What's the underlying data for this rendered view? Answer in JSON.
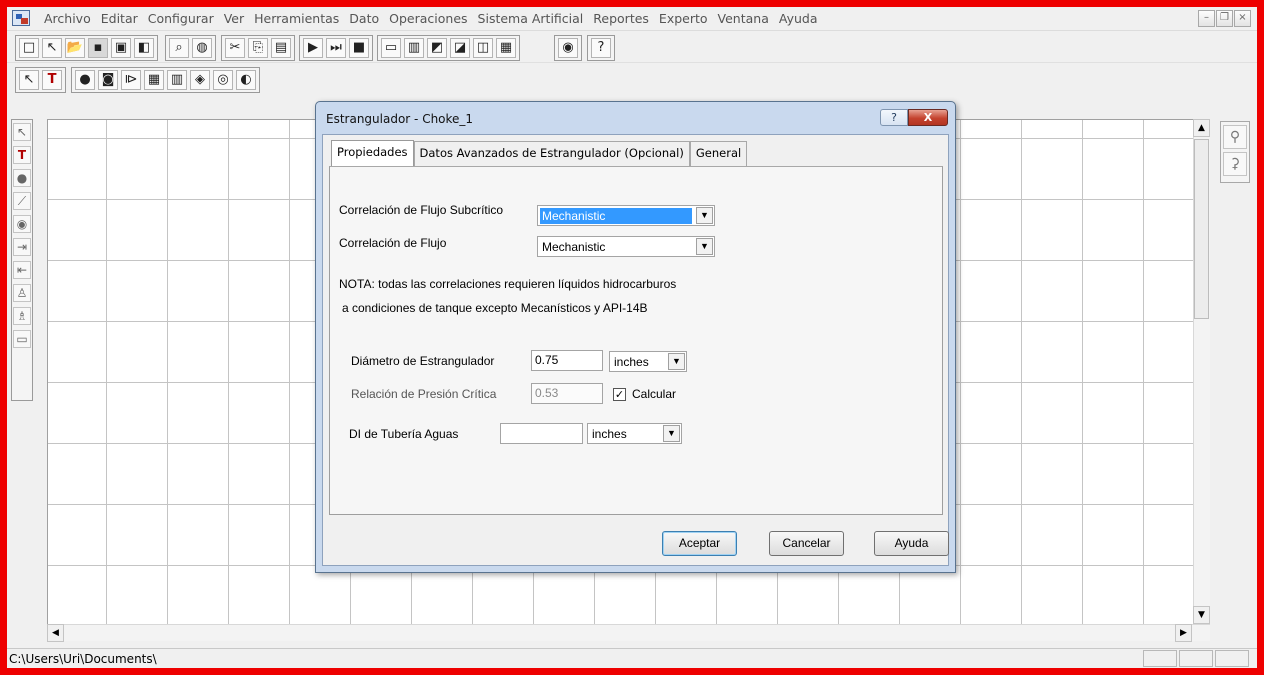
{
  "menubar": {
    "items": [
      "Archivo",
      "Editar",
      "Configurar",
      "Ver",
      "Herramientas",
      "Dato",
      "Operaciones",
      "Sistema Artificial",
      "Reportes",
      "Experto",
      "Ventana",
      "Ayuda"
    ]
  },
  "window_controls": {
    "minimize": "–",
    "restore": "❐",
    "close": "×"
  },
  "toolbar1": {
    "icons": [
      "new-icon",
      "pointer-icon",
      "open-icon",
      "save-icon",
      "print-preview-icon",
      "copy-window-icon",
      "find-icon",
      "globe-search-icon",
      "cut-icon",
      "copy-icon",
      "paste-icon",
      "run-icon",
      "run-step-icon",
      "stop-icon",
      "window-icon",
      "report-icon",
      "chart-icon",
      "plot-icon",
      "graph-icon",
      "table-icon",
      "internet-icon",
      "help-icon"
    ]
  },
  "toolbar2": {
    "icons": [
      "select-icon",
      "text-icon",
      "source-icon",
      "well-icon",
      "choke-icon",
      "separator-icon",
      "manifold-icon",
      "pump-icon",
      "compressor-icon",
      "heater-icon"
    ]
  },
  "left_toolbox": {
    "icons": [
      "pointer-icon",
      "text-tool-icon",
      "node-icon",
      "link-icon",
      "zoom-icon",
      "import-icon",
      "export-icon",
      "person-icon",
      "injector-icon",
      "misc-icon"
    ]
  },
  "right_toolbox": {
    "icons": [
      "tree-icon",
      "tree-expanded-icon"
    ]
  },
  "statusbar": {
    "path": "C:\\Users\\Uri\\Documents\\"
  },
  "dialog": {
    "title": "Estrangulador - Choke_1",
    "help_button": "?",
    "close_button": "X",
    "tabs": [
      {
        "label": "Propiedades",
        "active": true
      },
      {
        "label": "Datos Avanzados de Estrangulador (Opcional)",
        "active": false
      },
      {
        "label": "General",
        "active": false
      }
    ],
    "subcritical": {
      "label": "Correlación de Flujo Subcrítico",
      "value": "Mechanistic"
    },
    "critical": {
      "label": "Correlación de Flujo",
      "value": "Mechanistic"
    },
    "note_line1": "NOTA: todas las correlaciones  requieren líquidos hidrocarburos",
    "note_line2": "a condiciones de tanque excepto Mecanísticos y API-14B",
    "diameter": {
      "label": "Diámetro de Estrangulador",
      "value": "0.75",
      "unit": "inches"
    },
    "pressure_ratio": {
      "label": "Relación de Presión Crítica",
      "value": "0.53",
      "checkbox_label": "Calcular",
      "checked": true
    },
    "downstream_id": {
      "label": "DI de Tubería Aguas",
      "value": "",
      "unit": "inches"
    },
    "buttons": {
      "ok": "Aceptar",
      "cancel": "Cancelar",
      "help": "Ayuda"
    }
  }
}
